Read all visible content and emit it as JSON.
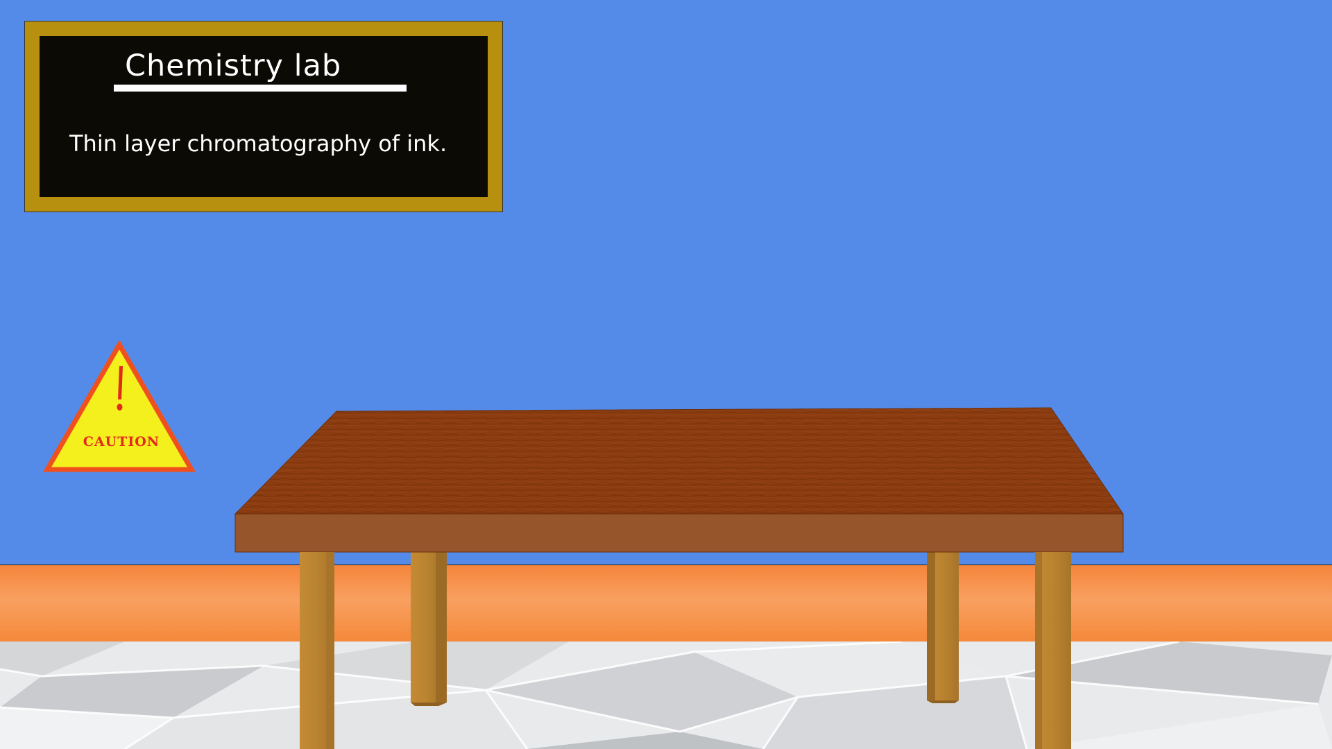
{
  "board": {
    "title": "Chemistry lab",
    "subtitle": "Thin layer chromatography of ink."
  },
  "caution": {
    "label": "CAUTION",
    "icon": "exclamation-icon"
  },
  "colors": {
    "wall": "#558be8",
    "baseboard": "#f5853c",
    "board_frame": "#b8900f",
    "board_surface": "#0b0a05",
    "table_top": "#8b3c10",
    "table_edge": "#96552a",
    "table_leg": "#b98330",
    "caution_fill": "#f3f01e",
    "caution_border": "#f0501e"
  }
}
